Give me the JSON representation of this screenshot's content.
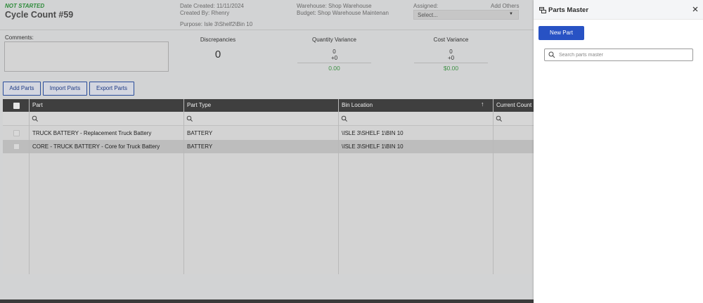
{
  "header": {
    "status": "NOT STARTED",
    "title": "Cycle Count #59",
    "date_created": "Date Created: 11/11/2024",
    "created_by": "Created By: Rhenry",
    "purpose": "Purpose: Isle 3\\Shelf2\\Bin 10",
    "warehouse": "Warehouse: Shop Warehouse",
    "budget": "Budget: Shop Warehouse Maintenan",
    "assigned_label": "Assigned:",
    "assigned_placeholder": "Select...",
    "add_others": "Add Others"
  },
  "comments": {
    "label": "Comments:"
  },
  "stats": {
    "discrepancies": {
      "label": "Discrepancies",
      "value": "0"
    },
    "quantity_variance": {
      "label": "Quantity Variance",
      "line1": "0",
      "line2": "+0",
      "total": "0.00"
    },
    "cost_variance": {
      "label": "Cost Variance",
      "line1": "0",
      "line2": "+0",
      "total": "$0.00"
    }
  },
  "actions": {
    "add_parts": "Add Parts",
    "import_parts": "Import Parts",
    "export_parts": "Export Parts"
  },
  "grid": {
    "columns": [
      "Part",
      "Part Type",
      "Bin Location",
      "Current Count"
    ],
    "rows": [
      {
        "part": "TRUCK BATTERY - Replacement Truck Battery",
        "type": "BATTERY",
        "bin": "\\ISLE 3\\SHELF 1\\BIN 10",
        "count": ""
      },
      {
        "part": "CORE - TRUCK BATTERY - Core for Truck Battery",
        "type": "BATTERY",
        "bin": "\\ISLE 3\\SHELF 1\\BIN 10",
        "count": ""
      }
    ]
  },
  "panel": {
    "title": "Parts Master",
    "new_part": "New Part",
    "search_placeholder": "Search parts master"
  },
  "colors": {
    "accent": "#2852c4",
    "status_green": "#2e8b3a",
    "grid_header": "#3f3f3f"
  }
}
